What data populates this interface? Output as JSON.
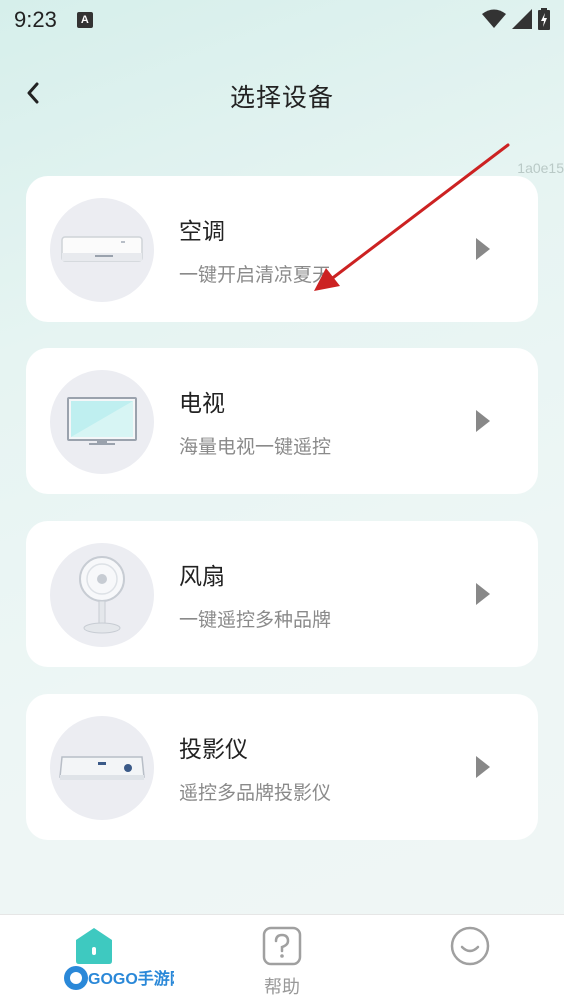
{
  "status": {
    "time": "9:23",
    "notification_badge": "A"
  },
  "header": {
    "title": "选择设备",
    "back_icon": "chevron-left-icon"
  },
  "watermark": "1a0e15",
  "devices": [
    {
      "title": "空调",
      "subtitle": "一键开启清凉夏天",
      "icon": "air-conditioner-icon"
    },
    {
      "title": "电视",
      "subtitle": "海量电视一键遥控",
      "icon": "tv-icon"
    },
    {
      "title": "风扇",
      "subtitle": "一键遥控多种品牌",
      "icon": "fan-icon"
    },
    {
      "title": "投影仪",
      "subtitle": "遥控多品牌投影仪",
      "icon": "projector-icon"
    }
  ],
  "tabbar": {
    "home_icon": "home-icon",
    "help_label": "帮助",
    "help_icon": "question-icon",
    "profile_icon": "smiley-icon"
  },
  "logo_text": "GOGO手游网",
  "colors": {
    "accent": "#3ec9c0",
    "card_bg": "#ffffff",
    "icon_circle": "#ecedf2",
    "annotation_arrow": "#cc2222"
  }
}
